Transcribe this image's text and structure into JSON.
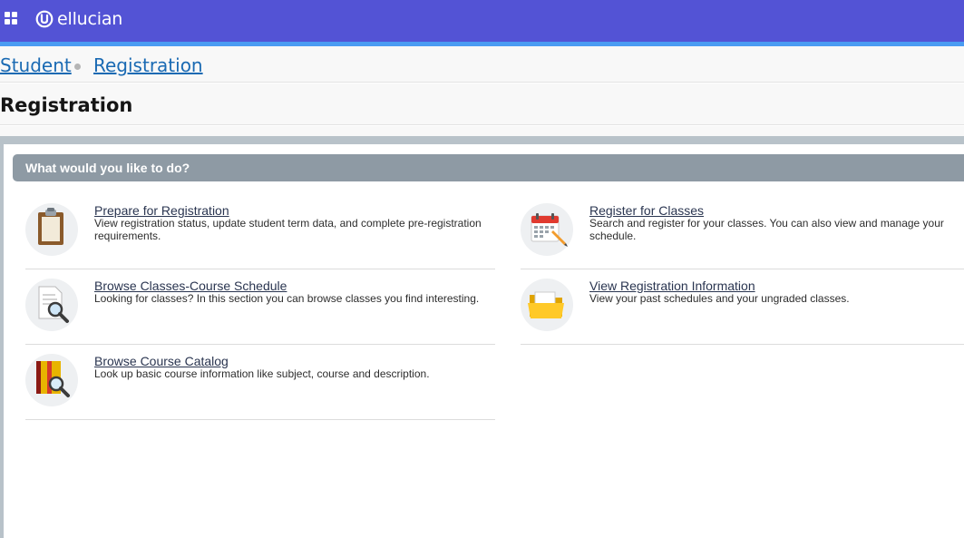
{
  "header": {
    "logo_text": "ellucian",
    "brand_color": "#5353d5",
    "accent_color": "#4a9cf2",
    "apps_icon": "apps-grid-icon"
  },
  "breadcrumb": {
    "items": [
      {
        "label": "Student"
      },
      {
        "label": "Registration"
      }
    ]
  },
  "page": {
    "title": "Registration"
  },
  "section": {
    "title": "What would you like to do?"
  },
  "actions": [
    {
      "title": "Prepare for Registration",
      "description": "View registration status, update student term data, and complete pre-registration requirements.",
      "icon": "clipboard-icon"
    },
    {
      "title": "Register for Classes",
      "description": "Search and register for your classes. You can also view and manage your schedule.",
      "icon": "calendar-edit-icon"
    },
    {
      "title": "Browse Classes-Course Schedule",
      "description": "Looking for classes? In this section you can browse classes you find interesting.",
      "icon": "document-search-icon"
    },
    {
      "title": "View Registration Information",
      "description": "View your past schedules and your ungraded classes.",
      "icon": "folder-icon"
    },
    {
      "title": "Browse Course Catalog",
      "description": "Look up basic course information like subject, course and description.",
      "icon": "book-search-icon"
    }
  ]
}
